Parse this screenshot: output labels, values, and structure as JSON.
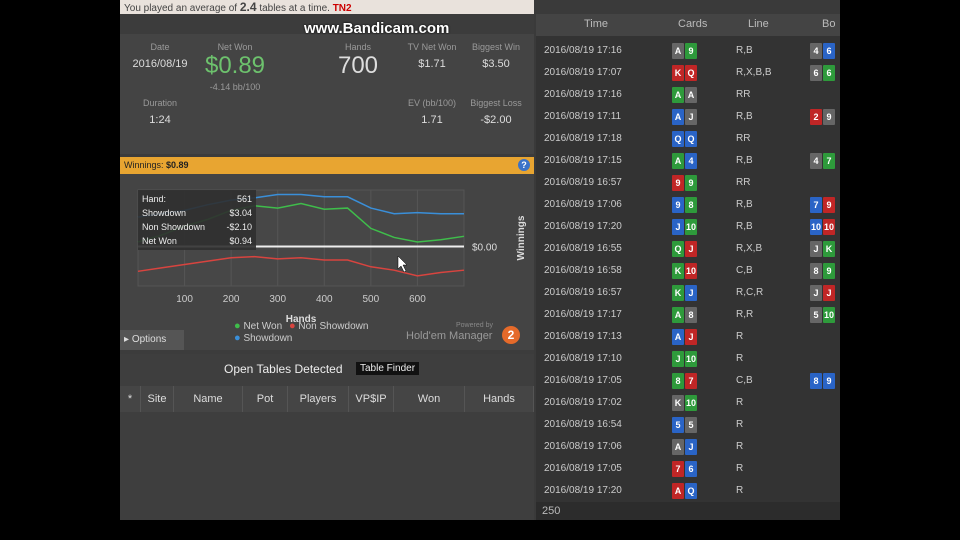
{
  "notice": {
    "prefix": "You played an average of",
    "tables": "2.4",
    "suffix": "tables at a time.",
    "tail_highlight": "TN2"
  },
  "watermark": "www.Bandicam.com",
  "stats": {
    "date_label": "Date",
    "date": "2016/08/19",
    "netwon_label": "Net Won",
    "netwon": "$0.89",
    "netwon_bb": "-4.14 bb/100",
    "hands_label": "Hands",
    "hands": "700",
    "tv_label": "TV Net Won",
    "tv": "$1.71",
    "bigwin_label": "Biggest Win",
    "bigwin": "$3.50",
    "duration_label": "Duration",
    "duration": "1:24",
    "ev_label": "EV (bb/100)",
    "ev": "1.71",
    "bigloss_label": "Biggest Loss",
    "bigloss": "-$2.00"
  },
  "winnings_bar": {
    "label": "Winnings:",
    "value": "$0.89"
  },
  "chart_data": {
    "type": "line",
    "xlabel": "Hands",
    "ylabel": "Winnings",
    "x_ticks": [
      "100",
      "200",
      "300",
      "400",
      "500",
      "600"
    ],
    "y_tick": "$0.00",
    "xlim": [
      0,
      700
    ],
    "series": [
      {
        "name": "Showdown",
        "color": "#3a8fd9",
        "x": [
          0,
          50,
          100,
          150,
          200,
          250,
          300,
          350,
          400,
          450,
          500,
          550,
          600,
          650,
          700
        ],
        "y": [
          2.6,
          2.9,
          3.2,
          3.7,
          4.1,
          4.3,
          4.6,
          4.6,
          4.4,
          4.4,
          3.4,
          2.9,
          3.0,
          2.9,
          2.9
        ]
      },
      {
        "name": "Net Won",
        "color": "#3fbd4b",
        "x": [
          0,
          50,
          100,
          150,
          200,
          250,
          300,
          350,
          400,
          450,
          500,
          550,
          600,
          650,
          700
        ],
        "y": [
          0.4,
          1.0,
          1.8,
          2.4,
          3.2,
          3.6,
          3.4,
          3.8,
          3.3,
          3.4,
          1.6,
          0.8,
          0.4,
          0.6,
          0.9
        ]
      },
      {
        "name": "Non Showdown",
        "color": "#d8443f",
        "x": [
          0,
          50,
          100,
          150,
          200,
          250,
          300,
          350,
          400,
          450,
          500,
          550,
          600,
          650,
          700
        ],
        "y": [
          -2.2,
          -1.9,
          -1.6,
          -1.3,
          -1.0,
          -0.9,
          -1.1,
          -1.0,
          -1.2,
          -1.2,
          -1.8,
          -2.1,
          -2.6,
          -2.3,
          -2.1
        ]
      }
    ],
    "tooltip": {
      "rows": [
        [
          "Hand:",
          "561"
        ],
        [
          "Showdown",
          "$3.04"
        ],
        [
          "Non Showdown",
          "-$2.10"
        ],
        [
          "Net Won",
          "$0.94"
        ]
      ]
    }
  },
  "legend": {
    "net_won": "Net Won",
    "non_showdown": "Non Showdown",
    "showdown": "Showdown"
  },
  "options_label": "Options",
  "brand": {
    "powered": "Powered by",
    "name": "Hold'em Manager",
    "logo": "2"
  },
  "open_tables": {
    "title": "Open Tables Detected",
    "finder": "Table Finder",
    "columns": [
      "*",
      "Site",
      "Name",
      "Pot",
      "Players",
      "VP$IP",
      "Won",
      "Hands"
    ]
  },
  "hand_list": {
    "headers": {
      "time": "Time",
      "cards": "Cards",
      "line": "Line",
      "board": "Bo"
    },
    "rows": [
      {
        "time": "2016/08/19 17:16",
        "cards": [
          [
            "A",
            "s"
          ],
          [
            "9",
            "c"
          ]
        ],
        "line": "R,B",
        "board": [
          [
            "4",
            "s"
          ],
          [
            "6",
            "d"
          ]
        ]
      },
      {
        "time": "2016/08/19 17:07",
        "cards": [
          [
            "K",
            "h"
          ],
          [
            "Q",
            "h"
          ]
        ],
        "line": "R,X,B,B",
        "board": [
          [
            "6",
            "s"
          ],
          [
            "6",
            "c"
          ]
        ]
      },
      {
        "time": "2016/08/19 17:16",
        "cards": [
          [
            "A",
            "c"
          ],
          [
            "A",
            "s"
          ]
        ],
        "line": "RR",
        "board": []
      },
      {
        "time": "2016/08/19 17:11",
        "cards": [
          [
            "A",
            "d"
          ],
          [
            "J",
            "s"
          ]
        ],
        "line": "R,B",
        "board": [
          [
            "2",
            "h"
          ],
          [
            "9",
            "s"
          ]
        ]
      },
      {
        "time": "2016/08/19 17:18",
        "cards": [
          [
            "Q",
            "d"
          ],
          [
            "Q",
            "d"
          ]
        ],
        "line": "RR",
        "board": []
      },
      {
        "time": "2016/08/19 17:15",
        "cards": [
          [
            "A",
            "c"
          ],
          [
            "4",
            "d"
          ]
        ],
        "line": "R,B",
        "board": [
          [
            "4",
            "s"
          ],
          [
            "7",
            "c"
          ]
        ]
      },
      {
        "time": "2016/08/19 16:57",
        "cards": [
          [
            "9",
            "h"
          ],
          [
            "9",
            "c"
          ]
        ],
        "line": "RR",
        "board": []
      },
      {
        "time": "2016/08/19 17:06",
        "cards": [
          [
            "9",
            "d"
          ],
          [
            "8",
            "c"
          ]
        ],
        "line": "R,B",
        "board": [
          [
            "7",
            "d"
          ],
          [
            "9",
            "h"
          ]
        ]
      },
      {
        "time": "2016/08/19 17:20",
        "cards": [
          [
            "J",
            "d"
          ],
          [
            "10",
            "c"
          ]
        ],
        "line": "R,B",
        "board": [
          [
            "10",
            "d"
          ],
          [
            "10",
            "h"
          ]
        ]
      },
      {
        "time": "2016/08/19 16:55",
        "cards": [
          [
            "Q",
            "c"
          ],
          [
            "J",
            "h"
          ]
        ],
        "line": "R,X,B",
        "board": [
          [
            "J",
            "s"
          ],
          [
            "K",
            "c"
          ]
        ]
      },
      {
        "time": "2016/08/19 16:58",
        "cards": [
          [
            "K",
            "c"
          ],
          [
            "10",
            "h"
          ]
        ],
        "line": "C,B",
        "board": [
          [
            "8",
            "s"
          ],
          [
            "9",
            "c"
          ]
        ]
      },
      {
        "time": "2016/08/19 16:57",
        "cards": [
          [
            "K",
            "c"
          ],
          [
            "J",
            "d"
          ]
        ],
        "line": "R,C,R",
        "board": [
          [
            "J",
            "s"
          ],
          [
            "J",
            "h"
          ]
        ]
      },
      {
        "time": "2016/08/19 17:17",
        "cards": [
          [
            "A",
            "c"
          ],
          [
            "8",
            "s"
          ]
        ],
        "line": "R,R",
        "board": [
          [
            "5",
            "s"
          ],
          [
            "10",
            "c"
          ]
        ]
      },
      {
        "time": "2016/08/19 17:13",
        "cards": [
          [
            "A",
            "d"
          ],
          [
            "J",
            "h"
          ]
        ],
        "line": "R",
        "board": []
      },
      {
        "time": "2016/08/19 17:10",
        "cards": [
          [
            "J",
            "c"
          ],
          [
            "10",
            "c"
          ]
        ],
        "line": "R",
        "board": []
      },
      {
        "time": "2016/08/19 17:05",
        "cards": [
          [
            "8",
            "c"
          ],
          [
            "7",
            "h"
          ]
        ],
        "line": "C,B",
        "board": [
          [
            "8",
            "d"
          ],
          [
            "9",
            "d"
          ]
        ]
      },
      {
        "time": "2016/08/19 17:02",
        "cards": [
          [
            "K",
            "s"
          ],
          [
            "10",
            "c"
          ]
        ],
        "line": "R",
        "board": []
      },
      {
        "time": "2016/08/19 16:54",
        "cards": [
          [
            "5",
            "d"
          ],
          [
            "5",
            "s"
          ]
        ],
        "line": "R",
        "board": []
      },
      {
        "time": "2016/08/19 17:06",
        "cards": [
          [
            "A",
            "s"
          ],
          [
            "J",
            "d"
          ]
        ],
        "line": "R",
        "board": []
      },
      {
        "time": "2016/08/19 17:05",
        "cards": [
          [
            "7",
            "h"
          ],
          [
            "6",
            "d"
          ]
        ],
        "line": "R",
        "board": []
      },
      {
        "time": "2016/08/19 17:20",
        "cards": [
          [
            "A",
            "h"
          ],
          [
            "Q",
            "d"
          ]
        ],
        "line": "R",
        "board": []
      }
    ],
    "footer": "250"
  }
}
